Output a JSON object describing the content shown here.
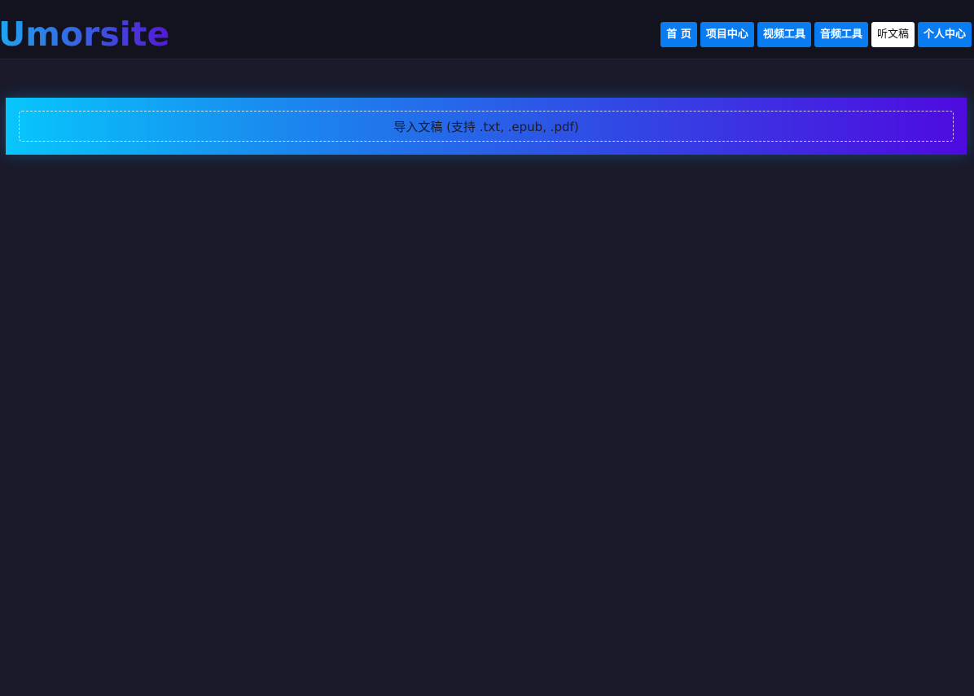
{
  "header": {
    "logo_text": "Umorsite",
    "nav": [
      {
        "label": "首 页",
        "active": false
      },
      {
        "label": "项目中心",
        "active": false
      },
      {
        "label": "视频工具",
        "active": false
      },
      {
        "label": "音频工具",
        "active": false
      },
      {
        "label": "听文稿",
        "active": true
      },
      {
        "label": "个人中心",
        "active": false
      }
    ]
  },
  "import": {
    "label": "导入文稿 (支持 .txt, .epub, .pdf)"
  },
  "colors": {
    "background": "#1a1a2a",
    "topbar": "#13131f",
    "nav_button": "#0a7cf2",
    "nav_button_active": "#ffffff",
    "gradient_start": "#07c6fb",
    "gradient_end": "#4f0ae0"
  }
}
